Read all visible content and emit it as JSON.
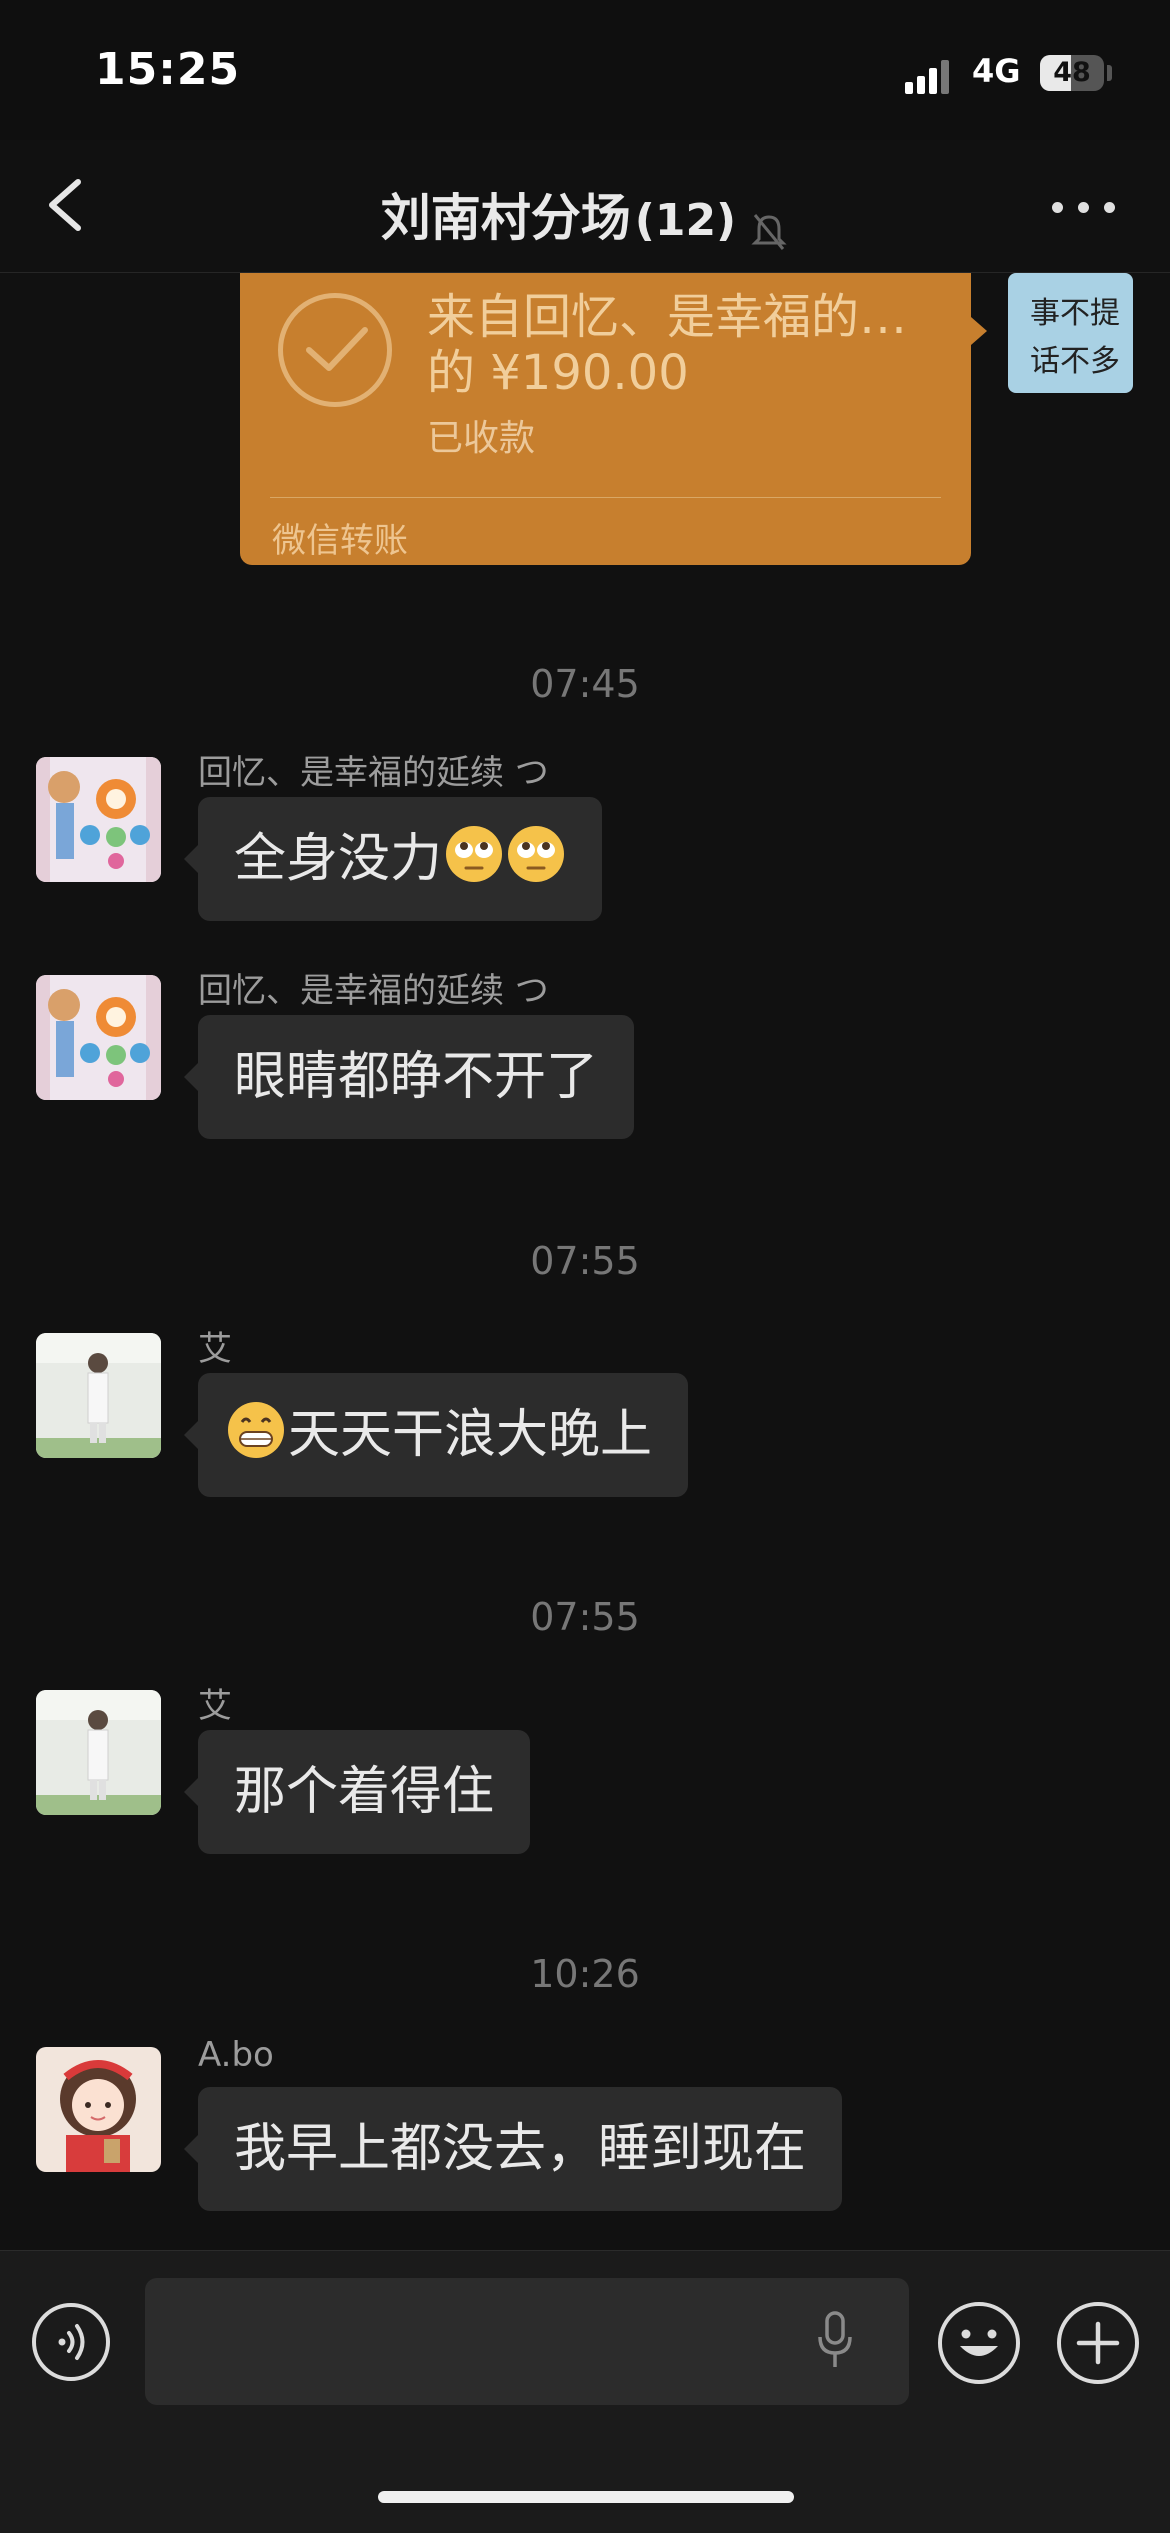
{
  "status_bar": {
    "time": "15:25",
    "network": "4G",
    "battery": "48",
    "battery_level": 0.48
  },
  "header": {
    "title": "刘南村分场",
    "member_count": "(12)"
  },
  "transfer_card": {
    "title": "来自回忆、是幸福的…的 ¥190.00",
    "status": "已收款",
    "footer": "微信转账",
    "sticker_text_line1": "事不提",
    "sticker_text_line2": "话不多"
  },
  "messages": [
    {
      "timestamp": "07:45",
      "sender": "回忆、是幸福的延续 つ",
      "text": "全身没力",
      "emoji": [
        "rolling-eyes-face",
        "rolling-eyes-face"
      ]
    },
    {
      "timestamp": "",
      "sender": "回忆、是幸福的延续 つ",
      "text": "眼睛都睁不开了",
      "emoji": []
    },
    {
      "timestamp": "07:55",
      "sender": "艾",
      "text": "天天干浪大晚上",
      "emoji": [
        "grinning-face"
      ]
    },
    {
      "timestamp": "07:55",
      "sender": "艾",
      "text": "那个着得住",
      "emoji": []
    },
    {
      "timestamp": "10:26",
      "sender": "A.bo",
      "text": "我早上都没去，睡到现在",
      "emoji": []
    }
  ],
  "input": {
    "placeholder": ""
  },
  "colors": {
    "background": "#111111",
    "bubble": "#2c2c2c",
    "transfer": "#c77f2e"
  }
}
